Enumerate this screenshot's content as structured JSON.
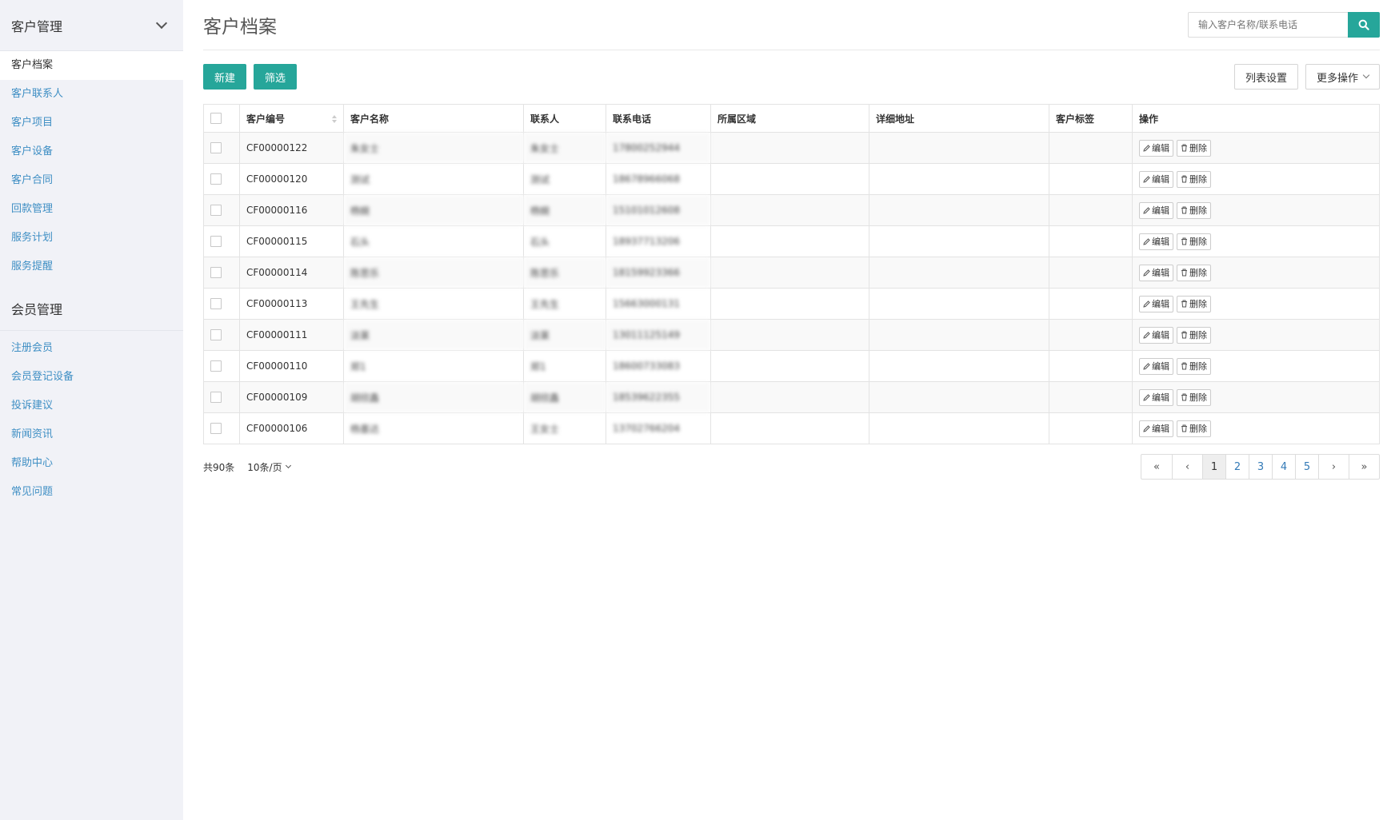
{
  "sidebar": {
    "group1": "客户管理",
    "items1": [
      "客户档案",
      "客户联系人",
      "客户项目",
      "客户设备",
      "客户合同",
      "回款管理",
      "服务计划",
      "服务提醒"
    ],
    "group2": "会员管理",
    "items2": [
      "注册会员",
      "会员登记设备",
      "投诉建议",
      "新闻资讯",
      "帮助中心",
      "常见问题"
    ]
  },
  "header": {
    "title": "客户档案",
    "search_placeholder": "输入客户名称/联系电话"
  },
  "toolbar": {
    "new_label": "新建",
    "filter_label": "筛选",
    "columns_label": "列表设置",
    "more_label": "更多操作"
  },
  "table": {
    "columns": [
      "客户编号",
      "客户名称",
      "联系人",
      "联系电话",
      "所属区域",
      "详细地址",
      "客户标签",
      "操作"
    ],
    "edit_label": "编辑",
    "delete_label": "删除",
    "rows": [
      {
        "id": "CF00000122",
        "name": "朱女士",
        "contact": "朱女士",
        "phone": "17800252944"
      },
      {
        "id": "CF00000120",
        "name": "测试",
        "contact": "测试",
        "phone": "18678966068"
      },
      {
        "id": "CF00000116",
        "name": "杨婉",
        "contact": "杨婉",
        "phone": "15101012608"
      },
      {
        "id": "CF00000115",
        "name": "石头",
        "contact": "石头",
        "phone": "18937713206"
      },
      {
        "id": "CF00000114",
        "name": "陈思乐",
        "contact": "陈思乐",
        "phone": "18159923366"
      },
      {
        "id": "CF00000113",
        "name": "王先生",
        "contact": "王先生",
        "phone": "15663000131"
      },
      {
        "id": "CF00000111",
        "name": "淡莱",
        "contact": "淡莱",
        "phone": "13011125149"
      },
      {
        "id": "CF00000110",
        "name": "郑1",
        "contact": "郑1",
        "phone": "18600733083"
      },
      {
        "id": "CF00000109",
        "name": "胡欣鑫",
        "contact": "胡欣鑫",
        "phone": "18539622355"
      },
      {
        "id": "CF00000106",
        "name": "杨墨达",
        "contact": "王女士",
        "phone": "13702766204"
      }
    ]
  },
  "pagination": {
    "total": "共90条",
    "per_page": "10条/页",
    "first": "«",
    "prev": "‹",
    "pages": [
      "1",
      "2",
      "3",
      "4",
      "5"
    ],
    "next": "›",
    "last": "»",
    "current": 1
  },
  "colors": {
    "accent": "#26a69a",
    "link": "#3f8fc4"
  }
}
